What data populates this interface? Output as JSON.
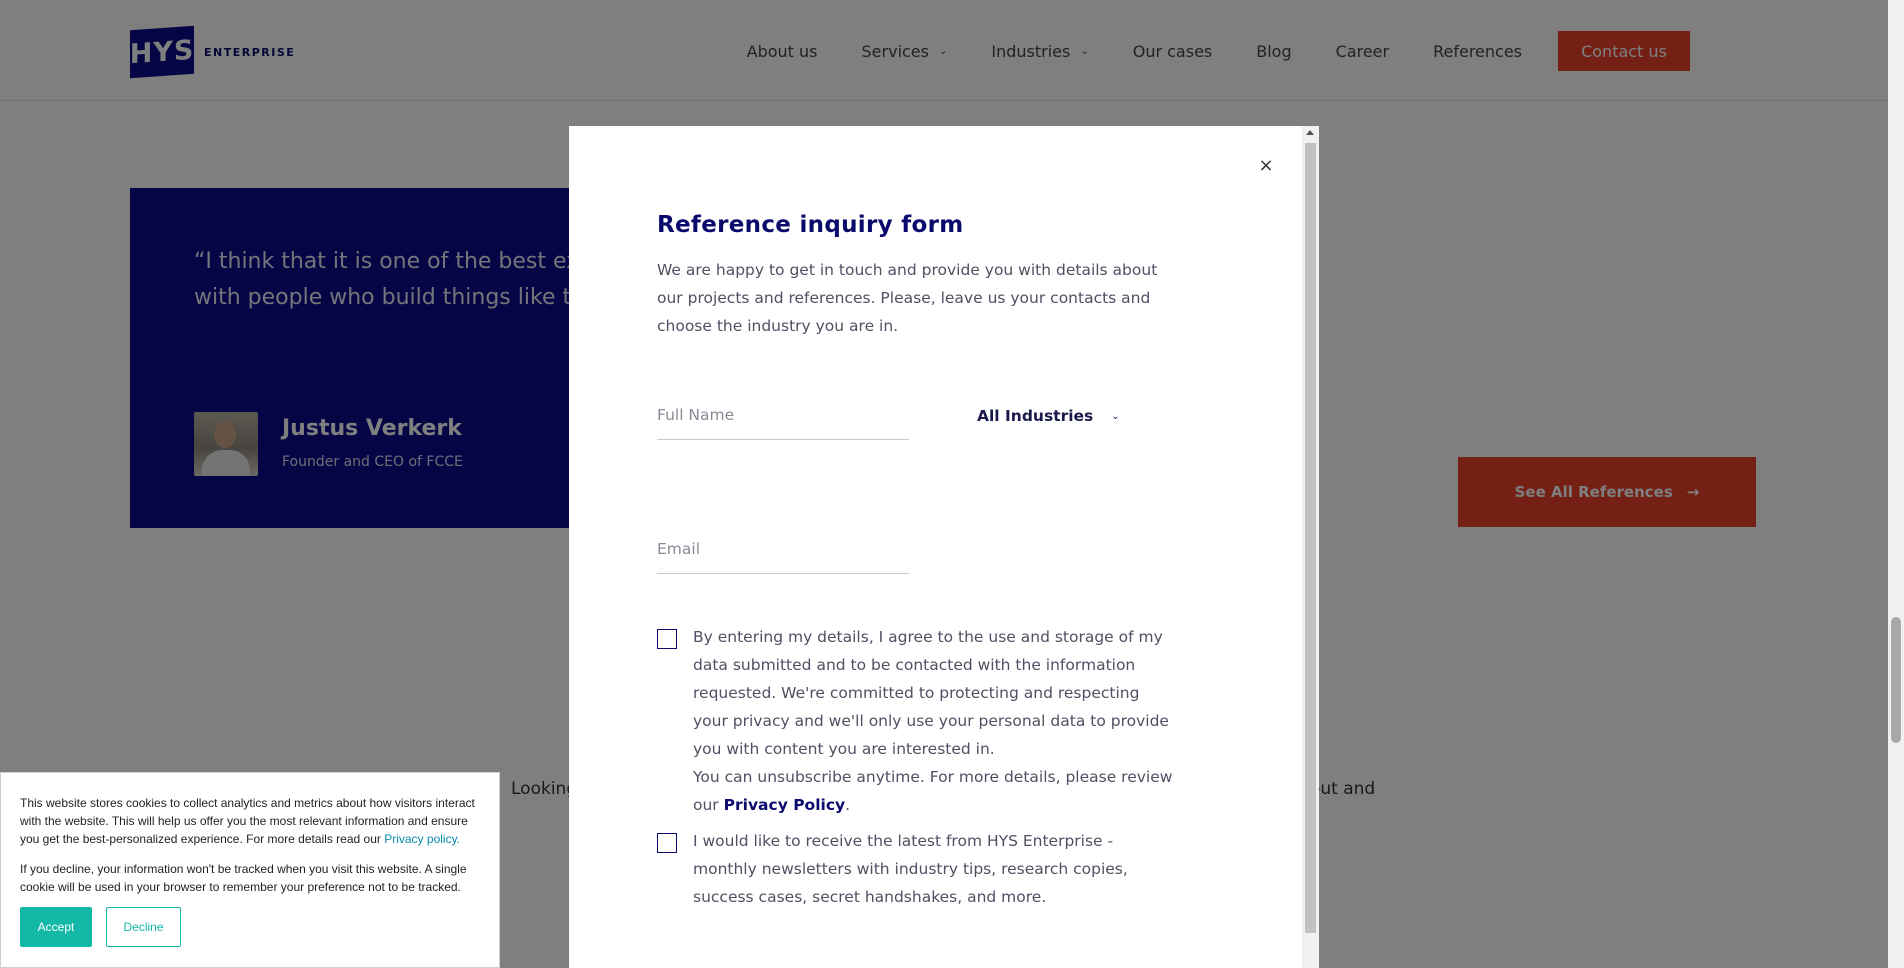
{
  "header": {
    "logo_mark": "HYS",
    "logo_text": "ENTERPRISE",
    "nav": [
      {
        "label": "About us",
        "dropdown": false
      },
      {
        "label": "Services",
        "dropdown": true
      },
      {
        "label": "Industries",
        "dropdown": true
      },
      {
        "label": "Our cases",
        "dropdown": false
      },
      {
        "label": "Blog",
        "dropdown": false
      },
      {
        "label": "Career",
        "dropdown": false
      },
      {
        "label": "References",
        "dropdown": false
      }
    ],
    "contact_label": "Contact us"
  },
  "testimonial": {
    "quote_line1": "“I think that it is one of the best ex",
    "quote_line2": "with people who build things like t",
    "name": "Justus Verkerk",
    "role": "Founder and CEO of FCCE"
  },
  "see_all_label": "See All References",
  "background_text": {
    "left": "Looking",
    "right": "out and"
  },
  "modal": {
    "close_glyph": "×",
    "title": "Reference inquiry form",
    "description": "We are happy to get in touch and provide you with details about our projects and references. Please, leave us your contacts and choose the industry you are in.",
    "full_name_placeholder": "Full Name",
    "full_name_value": "",
    "email_placeholder": "Email",
    "email_value": "",
    "industry_selected": "All Industries",
    "consent_text": "By entering my details, I agree to the use and storage of my data submitted and to be contacted with the information requested. We're committed to protecting and respecting your privacy and we'll only use your personal data to provide you with content you are interested in.",
    "consent_text_2": "You can unsubscribe anytime. For more details, please review our",
    "privacy_link": "Privacy Policy",
    "privacy_suffix": ".",
    "consent_checked": false,
    "newsletter_text": "I would like to receive the latest from HYS Enterprise - monthly newsletters with industry tips, research copies, success cases, secret handshakes, and more.",
    "newsletter_checked": false
  },
  "cookie_banner": {
    "text_1": "This website stores cookies to collect analytics and metrics about how visitors interact with the website. This will help us offer you the most relevant information and ensure you get the best-personalized experience. For more details read our",
    "privacy_link": "Privacy policy.",
    "text_2": "If you decline, your information won't be tracked when you visit this website. A single cookie will be used in your browser to remember your preference not to be tracked.",
    "accept_label": "Accept",
    "decline_label": "Decline"
  },
  "colors": {
    "brand_navy": "#0a0a8c",
    "accent_red": "#e8402a",
    "cookie_teal": "#14b8a6"
  }
}
